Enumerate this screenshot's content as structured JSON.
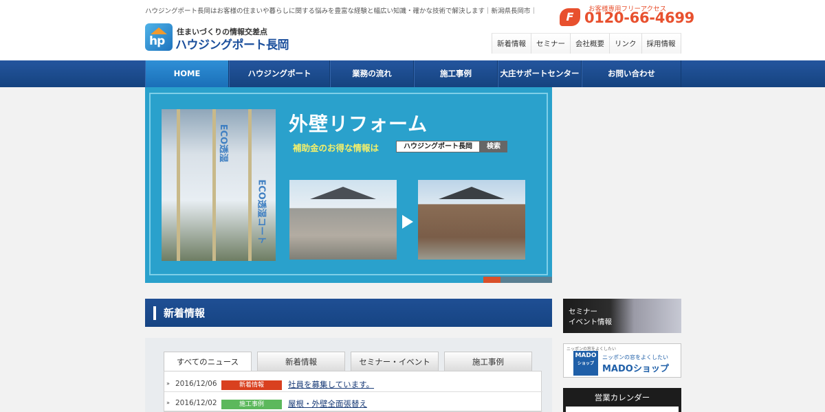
{
  "header": {
    "tagline": "ハウジングポート長岡はお客様の住まいや暮らしに関する悩みを豊富な経験と幅広い知識・確かな技術で解決します｜新潟県長岡市｜",
    "logo_sub": "住まいづくりの情報交差点",
    "logo_name": "ハウジングポート長岡",
    "logo_mark": "hp",
    "tel_caption": "お客様専用フリーアクセス",
    "tel_icon": "F",
    "tel_number": "0120-66-4699",
    "subnav": [
      "新着情報",
      "セミナー",
      "会社概要",
      "リンク",
      "採用情報"
    ]
  },
  "mainnav": {
    "items": [
      "HOME",
      "ハウジングポート",
      "業務の流れ",
      "施工事例",
      "大庄サポートセンター",
      "お問い合わせ"
    ]
  },
  "banner": {
    "title": "外壁リフォーム",
    "sub": "補助金のお得な情報は",
    "search_text": "ハウジングポート長岡",
    "search_button": "検索",
    "wall_text_1": "ECO透湿",
    "wall_text_2": "ECO透湿コート",
    "progress": {
      "active_index": 0,
      "count": 2
    }
  },
  "news": {
    "section_title": "新着情報",
    "tabs": [
      "すべてのニュース",
      "新着情報",
      "セミナー・イベント",
      "施工事例"
    ],
    "active_tab": 0,
    "rows": [
      {
        "date": "2016/12/06",
        "category": "新着情報",
        "category_color": "#d9401f",
        "title": "社員を募集しています。"
      },
      {
        "date": "2016/12/02",
        "category": "施工事例",
        "category_color": "#5cb85c",
        "title": "屋根・外壁全面張替え"
      }
    ]
  },
  "sidebar": {
    "seminar_line1": "セミナー",
    "seminar_line2": "イベント情報",
    "mado_small": "ニッポンの窓をよくしたい",
    "mado_badge": "MADO",
    "mado_badge_sub": "ショップ",
    "mado_tag": "ニッポンの窓をよくしたい",
    "mado_name": "MADOショップ",
    "calendar_title": "営業カレンダー"
  },
  "colors": {
    "nav_blue": "#1b4f94",
    "accent_orange": "#e8502e",
    "banner_cyan": "#2aa1cc"
  }
}
